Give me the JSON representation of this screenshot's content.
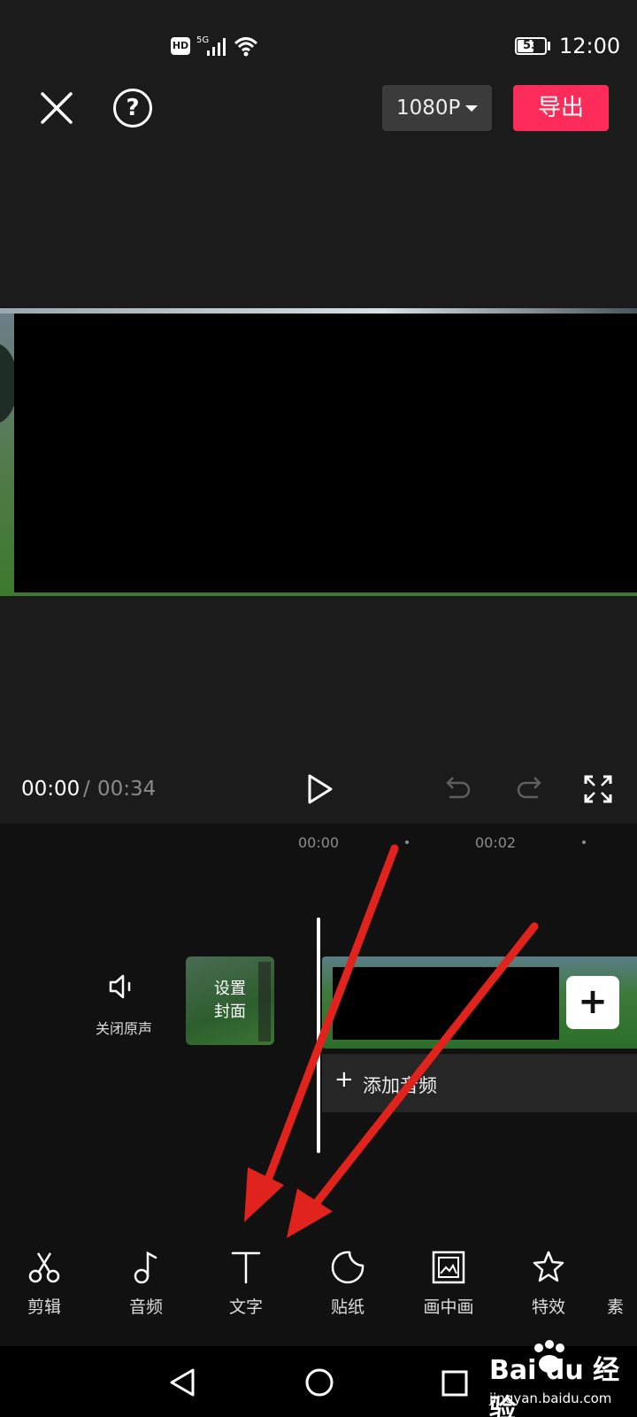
{
  "status_bar": {
    "hd": "HD",
    "network": "5G",
    "battery": "53",
    "time": "12:00"
  },
  "toolbar": {
    "resolution": "1080P",
    "export_label": "导出"
  },
  "playback": {
    "current_time": "00:00",
    "separator": "/",
    "total_time": "00:34"
  },
  "timeline": {
    "ticks": [
      "00:00",
      "00:02"
    ],
    "mute_label": "关闭原声",
    "cover_label_line1": "设置",
    "cover_label_line2": "封面",
    "add_clip": "+",
    "add_audio_plus": "+",
    "add_audio_label": "添加音频"
  },
  "tools": [
    {
      "label": "剪辑",
      "icon": "scissors-icon"
    },
    {
      "label": "音频",
      "icon": "music-note-icon"
    },
    {
      "label": "文字",
      "icon": "text-icon"
    },
    {
      "label": "贴纸",
      "icon": "sticker-icon"
    },
    {
      "label": "画中画",
      "icon": "picture-in-picture-icon"
    },
    {
      "label": "特效",
      "icon": "effects-star-icon"
    },
    {
      "label": "素",
      "icon": "material-icon"
    }
  ],
  "watermark": {
    "logo": "Bai du 经验",
    "url": "jingyan.baidu.com"
  },
  "colors": {
    "accent": "#fb2c59",
    "background": "#1b1b1b",
    "arrow": "#e0231d"
  }
}
